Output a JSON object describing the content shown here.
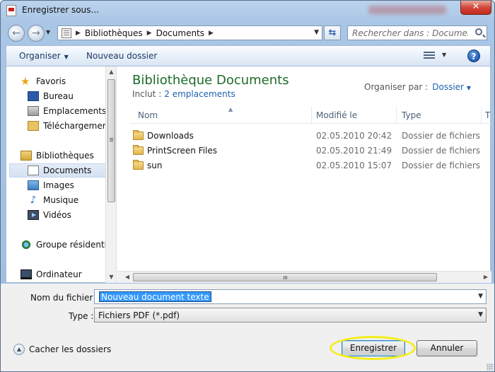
{
  "window": {
    "title": "Enregistrer sous..."
  },
  "address": {
    "breadcrumbs": [
      "Bibliothèques",
      "Documents"
    ],
    "search_placeholder": "Rechercher dans : Documents"
  },
  "toolbar": {
    "organise_label": "Organiser",
    "new_folder_label": "Nouveau dossier"
  },
  "sidebar": {
    "items": [
      {
        "label": "Favoris",
        "icon": "star-icon"
      },
      {
        "label": "Bureau",
        "icon": "desktop-icon"
      },
      {
        "label": "Emplacements ré",
        "icon": "recent-places-icon"
      },
      {
        "label": "Téléchargements",
        "icon": "downloads-icon"
      },
      {
        "label": "Bibliothèques",
        "icon": "library-icon"
      },
      {
        "label": "Documents",
        "icon": "documents-icon",
        "selected": true
      },
      {
        "label": "Images",
        "icon": "images-icon"
      },
      {
        "label": "Musique",
        "icon": "music-icon"
      },
      {
        "label": "Vidéos",
        "icon": "videos-icon"
      },
      {
        "label": "Groupe résidentiel",
        "icon": "homegroup-icon"
      },
      {
        "label": "Ordinateur",
        "icon": "computer-icon"
      }
    ]
  },
  "library": {
    "title": "Bibliothèque Documents",
    "includes_label": "Inclut :",
    "includes_link": "2 emplacements",
    "arrange_label": "Organiser par :",
    "arrange_value": "Dossier"
  },
  "files": {
    "columns": [
      "Nom",
      "Modifié le",
      "Type",
      "T"
    ],
    "rows": [
      {
        "name": "Downloads",
        "modified": "02.05.2010 20:42",
        "type": "Dossier de fichiers"
      },
      {
        "name": "PrintScreen Files",
        "modified": "02.05.2010 21:49",
        "type": "Dossier de fichiers"
      },
      {
        "name": "sun",
        "modified": "02.05.2010 15:07",
        "type": "Dossier de fichiers"
      }
    ]
  },
  "form": {
    "filename_label": "Nom du fichier :",
    "filename_value": "Nouveau document texte",
    "type_label": "Type :",
    "type_value": "Fichiers PDF (*.pdf)",
    "hide_folders_label": "Cacher les dossiers",
    "save_label": "Enregistrer",
    "cancel_label": "Annuler"
  },
  "colors": {
    "library_title": "#1e6b2a",
    "link": "#1e62b0",
    "highlight": "#f3ee1a",
    "selection": "#3399ff"
  }
}
